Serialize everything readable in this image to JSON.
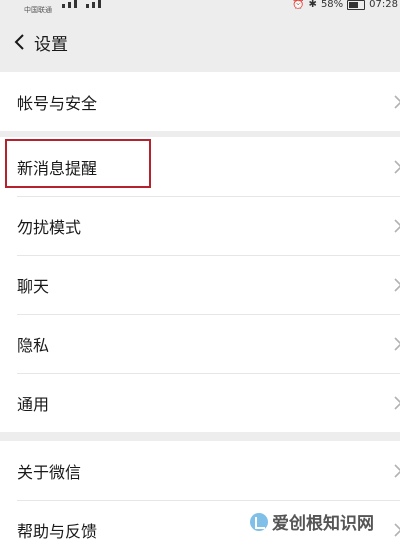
{
  "status_bar": {
    "carrier": "中国联通",
    "battery": "58%",
    "time": "07:28"
  },
  "header": {
    "title": "设置"
  },
  "groups": [
    {
      "items": [
        {
          "label": "帐号与安全"
        }
      ]
    },
    {
      "items": [
        {
          "label": "新消息提醒"
        },
        {
          "label": "勿扰模式"
        },
        {
          "label": "聊天"
        },
        {
          "label": "隐私"
        },
        {
          "label": "通用"
        }
      ]
    },
    {
      "items": [
        {
          "label": "关于微信"
        },
        {
          "label": "帮助与反馈"
        }
      ]
    }
  ],
  "highlight": {
    "target": "新消息提醒",
    "color": "#b5222e"
  },
  "watermark": {
    "text": "爱创根知识网"
  },
  "colors": {
    "background": "#ededed",
    "surface": "#ffffff",
    "text": "#191919",
    "divider": "#e6e6e6",
    "chevron": "#b2b2b2"
  }
}
